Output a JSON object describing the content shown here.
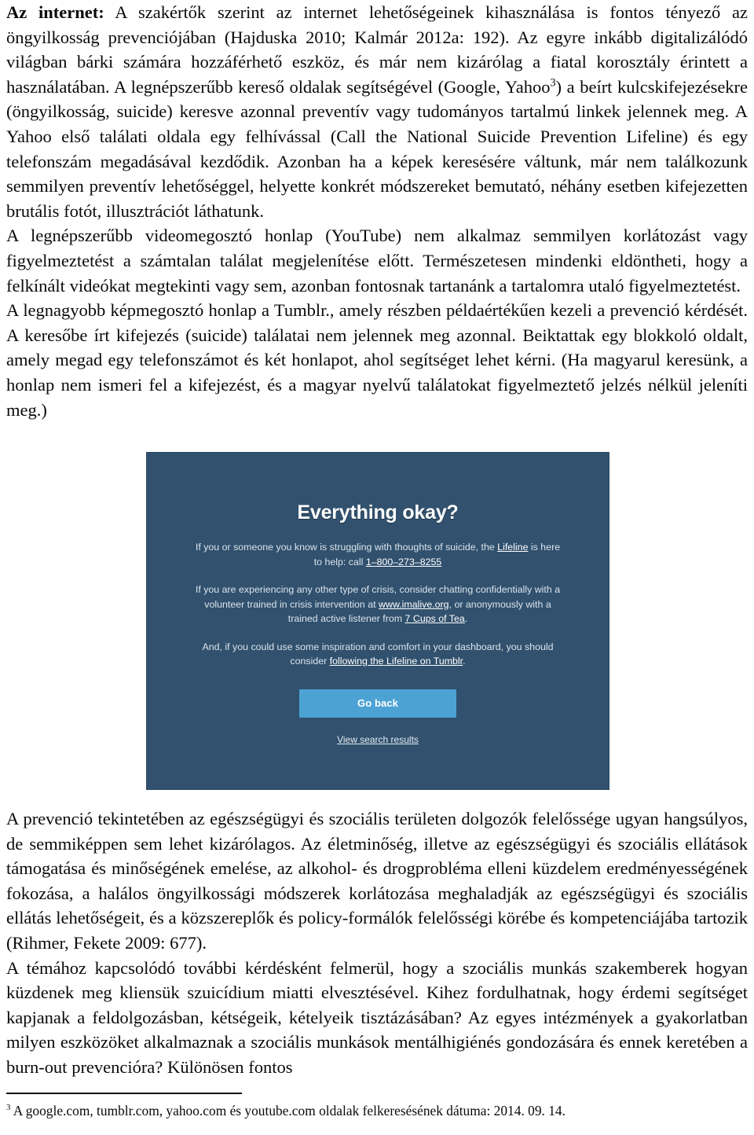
{
  "document": {
    "paragraphs": [
      {
        "id": "p1",
        "lead": "Az internet:",
        "text_before_footnote": " A szakértők szerint az internet lehetőségeinek kihasználása is fontos tényező az öngyilkosság prevenciójában (Hajduska 2010; Kalmár 2012a: 192). Az egyre inkább digitalizálódó világban bárki számára hozzáférhető eszköz, és már nem kizárólag a fiatal korosztály érintett a használatában. A legnépszerűbb kereső oldalak segítségével (Google, Yahoo",
        "footnote_marker": "3",
        "text_after_footnote": ") a beírt kulcskifejezésekre (öngyilkosság, suicide) keresve azonnal preventív vagy tudományos tartalmú linkek jelennek meg. A Yahoo első találati oldala egy felhívással (Call the National Suicide Prevention Lifeline) és egy telefonszám megadásával kezdődik. Azonban ha a képek keresésére váltunk, már nem találkozunk semmilyen preventív lehetőséggel, helyette konkrét módszereket bemutató, néhány esetben kifejezetten brutális fotót, illusztrációt láthatunk."
      },
      {
        "id": "p2",
        "text": "A legnépszerűbb videomegosztó honlap (YouTube) nem alkalmaz semmilyen korlátozást vagy figyelmeztetést a számtalan találat megjelenítése előtt. Természetesen mindenki eldöntheti, hogy a felkínált videókat megtekinti vagy sem, azonban fontosnak tartanánk a tartalomra utaló figyelmeztetést."
      },
      {
        "id": "p3",
        "text": "A legnagyobb képmegosztó honlap a Tumblr., amely részben példaértékűen kezeli a prevenció kérdését. A keresőbe írt kifejezés (suicide) találatai nem jelennek meg azonnal. Beiktattak egy blokkoló oldalt, amely megad egy telefonszámot és két honlapot, ahol segítséget lehet kérni. (Ha magyarul keresünk, a honlap nem ismeri fel a kifejezést, és a magyar nyelvű találatokat figyelmeztető jelzés nélkül jeleníti meg.)"
      },
      {
        "id": "p4",
        "text": "A prevenció tekintetében az egészségügyi és szociális területen dolgozók felelőssége ugyan hangsúlyos, de semmiképpen sem lehet kizárólagos. Az életminőség, illetve az egészségügyi és szociális ellátások támogatása és minőségének emelése, az alkohol- és drogprobléma elleni küzdelem eredményességének fokozása, a halálos öngyilkossági módszerek korlátozása meghaladják az egészségügyi és szociális ellátás lehetőségeit, és a közszereplők és policy-formálók felelősségi körébe és kompetenciájába tartozik (Rihmer, Fekete 2009: 677)."
      },
      {
        "id": "p5",
        "text": "A témához kapcsolódó további kérdésként felmerül, hogy a szociális munkás szakemberek hogyan küzdenek meg kliensük szuicídium miatti elvesztésével. Kihez fordulhatnak, hogy érdemi segítséget kapjanak a feldolgozásban, kétségeik, kételyeik tisztázásában? Az egyes intézmények a gyakorlatban milyen eszközöket alkalmaznak a szociális munkások mentálhigiénés gondozására és ennek keretében a burn-out prevencióra? Különösen fontos"
      }
    ]
  },
  "figure": {
    "title": "Everything okay?",
    "paragraph1_part1": "If you or someone you know is struggling with thoughts of suicide, the ",
    "paragraph1_link1": "Lifeline",
    "paragraph1_part2": " is here to help: call ",
    "paragraph1_link2": "1–800–273–8255",
    "paragraph2_part1": "If you are experiencing any other type of crisis, consider chatting confidentially with a volunteer trained in crisis intervention at ",
    "paragraph2_link1": "www.imalive.org",
    "paragraph2_part2": ", or anonymously with a trained active listener from ",
    "paragraph2_link2": "7 Cups of Tea",
    "paragraph2_part3": ".",
    "paragraph3_part1": "And, if you could use some inspiration and comfort in your dashboard, you should consider ",
    "paragraph3_link1": "following the Lifeline on Tumblr",
    "paragraph3_part2": ".",
    "go_back_label": "Go back",
    "view_results_label": "View search results",
    "colors": {
      "background": "#31516e",
      "button": "#4da2d4",
      "text": "#e9eef3",
      "title": "#ffffff"
    }
  },
  "footnote": {
    "marker": "3",
    "text": " A google.com, tumblr.com, yahoo.com és youtube.com oldalak felkeresésének dátuma: 2014. 09. 14."
  }
}
